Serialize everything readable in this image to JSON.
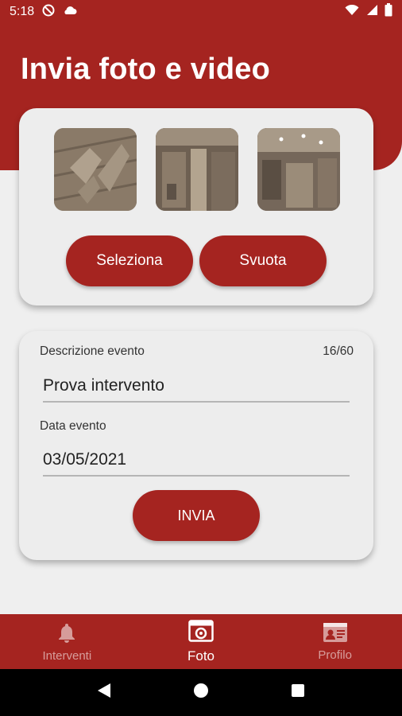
{
  "status_bar": {
    "time": "5:18"
  },
  "header": {
    "title": "Invia foto e video"
  },
  "photos": {
    "thumbnails": [
      "photo-1",
      "photo-2",
      "photo-3"
    ],
    "select_label": "Seleziona",
    "clear_label": "Svuota"
  },
  "form": {
    "description_label": "Descrizione evento",
    "description_counter": "16/60",
    "description_value": "Prova intervento",
    "date_label": "Data evento",
    "date_value": "03/05/2021",
    "submit_label": "INVIA"
  },
  "bottom_nav": {
    "items": [
      {
        "label": "Interventi",
        "icon": "bell-icon",
        "active": false
      },
      {
        "label": "Foto",
        "icon": "camera-icon",
        "active": true
      },
      {
        "label": "Profilo",
        "icon": "id-card-icon",
        "active": false
      }
    ]
  },
  "colors": {
    "primary": "#a52420",
    "background": "#efefef",
    "card": "#ededed"
  }
}
